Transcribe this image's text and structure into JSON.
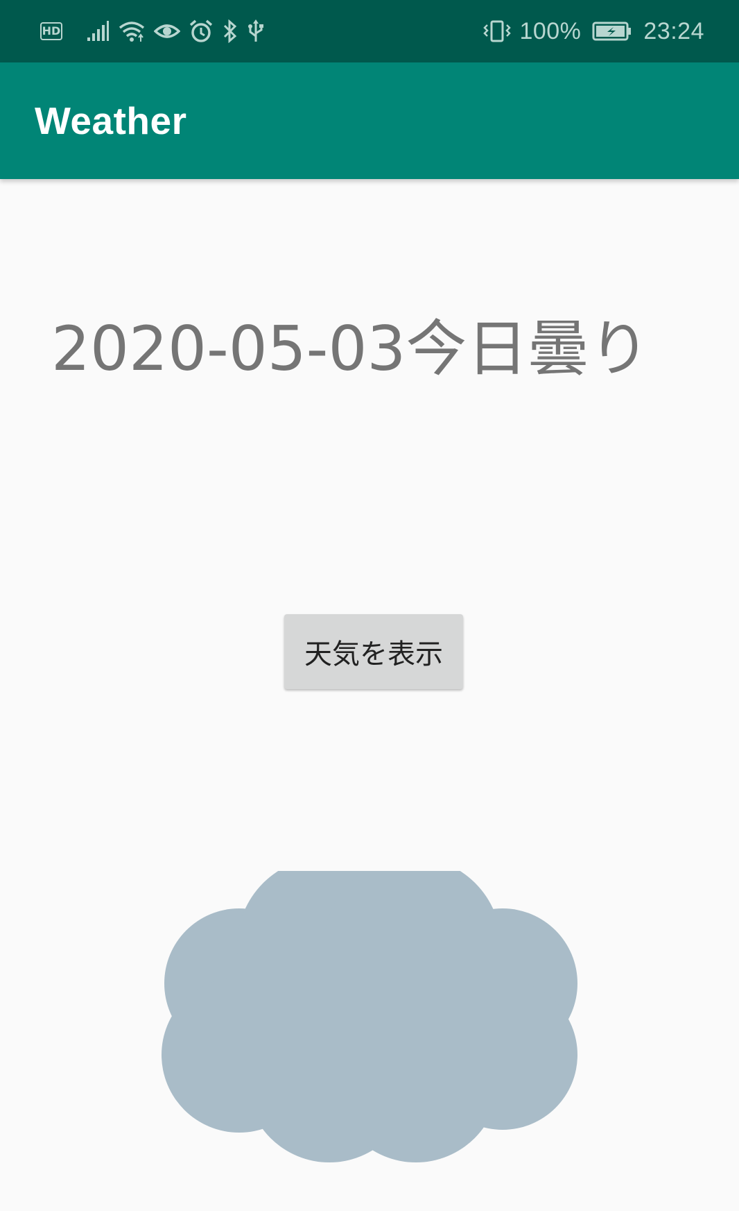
{
  "status_bar": {
    "hd_badge": "HD",
    "battery_percent": "100%",
    "time": "23:24",
    "icons": [
      "hd-icon",
      "signal-icon",
      "wifi-icon",
      "eye-icon",
      "alarm-icon",
      "bluetooth-icon",
      "usb-icon",
      "vibrate-icon",
      "battery-charging-icon"
    ]
  },
  "app_bar": {
    "title": "Weather"
  },
  "main": {
    "weather_text": "2020-05-03今日曇り",
    "show_button_label": "天気を表示",
    "weather_image": "cloud-icon"
  },
  "colors": {
    "status_bar": "#00594D",
    "app_bar": "#018576",
    "background": "#FAFAFA",
    "cloud": "#A9BCC8",
    "button": "#D6D7D7"
  }
}
